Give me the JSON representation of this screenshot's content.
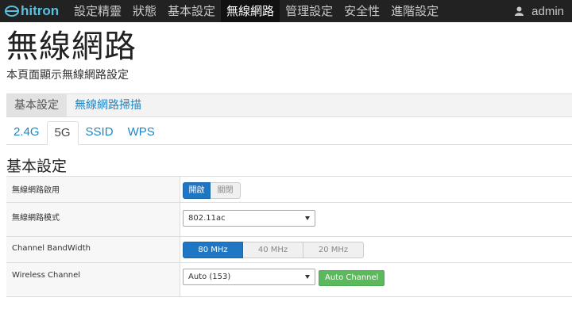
{
  "brand": {
    "name": "hitron"
  },
  "nav": {
    "items": [
      "設定精靈",
      "狀態",
      "基本設定",
      "無線網路",
      "管理設定",
      "安全性",
      "進階設定"
    ],
    "active_index": 3,
    "user": "admin"
  },
  "header": {
    "title": "無線網路",
    "description": "本頁面顯示無線網路設定"
  },
  "subtabs": [
    "基本設定",
    "無線網路掃描"
  ],
  "bandtabs": [
    "2.4G",
    "5G",
    "SSID",
    "WPS"
  ],
  "section": {
    "title": "基本設定"
  },
  "settings": {
    "enable": {
      "label": "無線網路啟用",
      "on": "開啟",
      "off": "關閉"
    },
    "mode": {
      "label": "無線網路模式",
      "value": "802.11ac"
    },
    "bandwidth": {
      "label": "Channel BandWidth",
      "options": [
        "80 MHz",
        "40 MHz",
        "20 MHz"
      ]
    },
    "channel": {
      "label": "Wireless Channel",
      "value": "Auto (153)",
      "button": "Auto Channel"
    }
  },
  "colors": {
    "navbar": "#222222",
    "accent": "#1f76c3",
    "link": "#1a86c8",
    "green": "#5cb85c"
  }
}
